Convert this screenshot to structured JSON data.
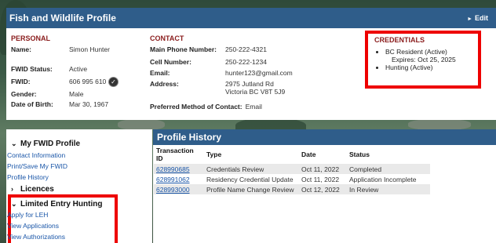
{
  "header": {
    "title": "Fish and Wildlife Profile",
    "edit_label": "Edit"
  },
  "personal": {
    "heading": "PERSONAL",
    "name_label": "Name:",
    "name": "Simon Hunter",
    "fwid_status_label": "FWID Status:",
    "fwid_status": "Active",
    "fwid_label": "FWID:",
    "fwid": "606 995 610",
    "gender_label": "Gender:",
    "gender": "Male",
    "dob_label": "Date of Birth:",
    "dob": "Mar 30, 1967"
  },
  "contact": {
    "heading": "CONTACT",
    "main_phone_label": "Main Phone Number:",
    "main_phone": "250-222-4321",
    "cell_label": "Cell Number:",
    "cell": "250-222-1234",
    "email_label": "Email:",
    "email": "hunter123@gmail.com",
    "address_label": "Address:",
    "address_line1": "2975 Jutland Rd",
    "address_line2": "Victoria BC V8T 5J9",
    "preferred_label": "Preferred Method of Contact:",
    "preferred": "Email"
  },
  "credentials": {
    "heading": "CREDENTIALS",
    "items": [
      {
        "label": "BC Resident (Active)",
        "sub": "Expires: Oct 25, 2025"
      },
      {
        "label": "Hunting (Active)"
      }
    ]
  },
  "nav": {
    "my_fwid": {
      "heading": "My FWID Profile",
      "links": [
        "Contact Information",
        "Print/Save My FWID",
        "Profile History"
      ]
    },
    "licences": {
      "heading": "Licences"
    },
    "leh": {
      "heading": "Limited Entry Hunting",
      "links": [
        "Apply for LEH",
        "View Applications",
        "View Authorizations"
      ]
    }
  },
  "history": {
    "title": "Profile History",
    "columns": [
      "Transaction ID",
      "Type",
      "Date",
      "Status"
    ],
    "rows": [
      [
        "628990685",
        "Credentials Review",
        "Oct 11, 2022",
        "Completed"
      ],
      [
        "628991062",
        "Residency Credential Update",
        "Oct 11, 2022",
        "Application Incomplete"
      ],
      [
        "628993000",
        "Profile Name Change Review",
        "Oct 12, 2022",
        "In Review"
      ]
    ]
  }
}
